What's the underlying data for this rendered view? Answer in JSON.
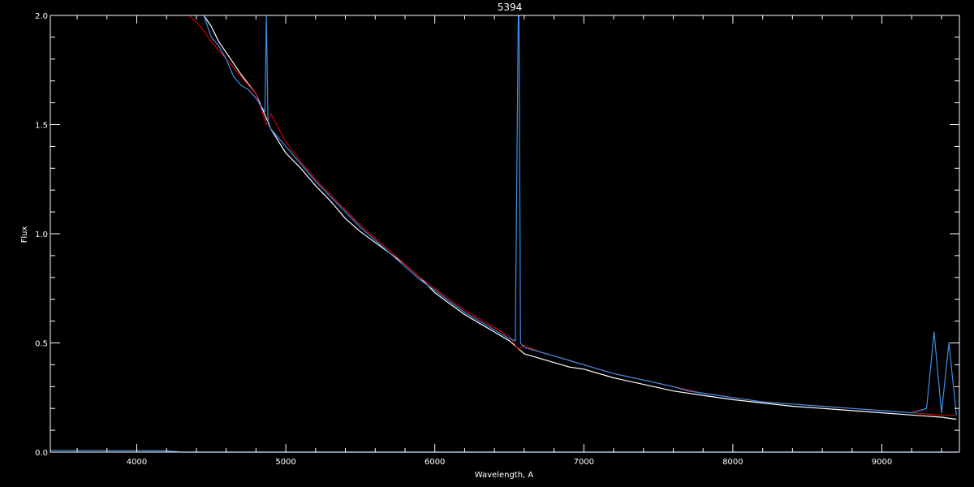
{
  "chart_data": {
    "type": "line",
    "title": "5394",
    "xlabel": "Wavelength, A",
    "ylabel": "Flux",
    "xlim": [
      3420,
      9520
    ],
    "ylim": [
      0.0,
      2.0
    ],
    "x_ticks": [
      4000,
      5000,
      6000,
      7000,
      8000,
      9000
    ],
    "y_ticks": [
      0.0,
      0.5,
      1.0,
      1.5,
      2.0
    ],
    "x_tick_labels": [
      "4000",
      "5000",
      "6000",
      "7000",
      "8000",
      "9000"
    ],
    "y_tick_labels": [
      "0.0",
      "0.5",
      "1.0",
      "1.5",
      "2.0"
    ],
    "grid": false,
    "background": "#000000",
    "axis_color": "#ffffff",
    "series": [
      {
        "color": "#ffffff",
        "x": [
          4450,
          4500,
          4550,
          4600,
          4700,
          4800,
          4900,
          5000,
          5100,
          5200,
          5300,
          5400,
          5500,
          5600,
          5700,
          5800,
          5900,
          6000,
          6100,
          6200,
          6300,
          6400,
          6500,
          6600,
          6700,
          6800,
          6900,
          7000,
          7200,
          7400,
          7600,
          7800,
          8000,
          8200,
          8400,
          8600,
          8800,
          9000,
          9200,
          9400,
          9500
        ],
        "y": [
          2.0,
          1.95,
          1.88,
          1.83,
          1.73,
          1.64,
          1.48,
          1.37,
          1.3,
          1.22,
          1.15,
          1.07,
          1.01,
          0.96,
          0.91,
          0.86,
          0.8,
          0.73,
          0.68,
          0.63,
          0.59,
          0.55,
          0.51,
          0.45,
          0.43,
          0.41,
          0.39,
          0.38,
          0.34,
          0.31,
          0.28,
          0.26,
          0.24,
          0.225,
          0.21,
          0.2,
          0.19,
          0.18,
          0.17,
          0.16,
          0.15
        ]
      },
      {
        "color": "#cc0000",
        "x": [
          4350,
          4400,
          4450,
          4500,
          4600,
          4700,
          4800,
          4870,
          4900,
          5000,
          5100,
          5200,
          5300,
          5400,
          5500,
          5600,
          5700,
          5800,
          5900,
          6000,
          6100,
          6200,
          6300,
          6400,
          6500,
          6560,
          6600,
          6700,
          6800,
          6900,
          7000,
          7200,
          7400,
          7600,
          7800,
          8000,
          8200,
          8400,
          8600,
          8800,
          9000,
          9200,
          9400,
          9500
        ],
        "y": [
          2.0,
          1.97,
          1.93,
          1.88,
          1.8,
          1.72,
          1.64,
          1.5,
          1.55,
          1.42,
          1.33,
          1.25,
          1.18,
          1.11,
          1.04,
          0.98,
          0.92,
          0.86,
          0.8,
          0.75,
          0.7,
          0.65,
          0.61,
          0.57,
          0.53,
          0.47,
          0.49,
          0.46,
          0.44,
          0.42,
          0.4,
          0.36,
          0.33,
          0.3,
          0.27,
          0.25,
          0.23,
          0.22,
          0.21,
          0.2,
          0.19,
          0.18,
          0.17,
          0.17
        ]
      },
      {
        "color": "#3b8fe8",
        "x": [
          4450,
          4500,
          4550,
          4600,
          4650,
          4700,
          4750,
          4800,
          4860,
          4870,
          4880,
          4900,
          5000,
          5100,
          5200,
          5300,
          5400,
          5500,
          5600,
          5700,
          5800,
          5900,
          6000,
          6100,
          6200,
          6300,
          6400,
          6500,
          6540,
          6560,
          6565,
          6575,
          6600,
          6700,
          6800,
          6900,
          7000,
          7200,
          7400,
          7600,
          7650,
          7700,
          7800,
          8000,
          8200,
          8400,
          8600,
          8800,
          9000,
          9200,
          9300,
          9350,
          9400,
          9450,
          9500
        ],
        "y": [
          2.0,
          1.9,
          1.86,
          1.8,
          1.72,
          1.68,
          1.66,
          1.62,
          1.56,
          2.0,
          1.52,
          1.48,
          1.4,
          1.32,
          1.24,
          1.17,
          1.1,
          1.03,
          0.97,
          0.91,
          0.85,
          0.79,
          0.74,
          0.69,
          0.64,
          0.6,
          0.56,
          0.52,
          0.51,
          2.0,
          2.0,
          0.5,
          0.48,
          0.46,
          0.44,
          0.42,
          0.4,
          0.36,
          0.33,
          0.3,
          0.29,
          0.28,
          0.27,
          0.25,
          0.23,
          0.22,
          0.21,
          0.2,
          0.19,
          0.18,
          0.2,
          0.55,
          0.18,
          0.5,
          0.17
        ]
      },
      {
        "color": "#3b8fe8",
        "x": [
          3420,
          4200,
          4300,
          6000,
          9500
        ],
        "y": [
          0.008,
          0.006,
          0.0,
          0.0,
          0.0
        ]
      }
    ]
  }
}
